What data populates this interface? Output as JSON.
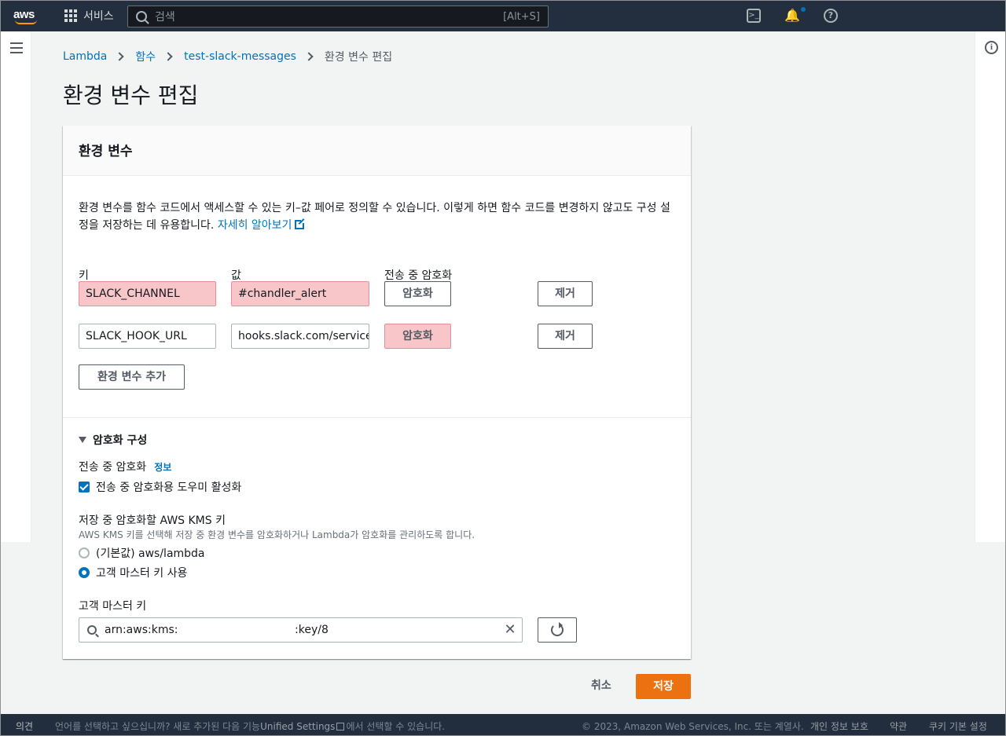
{
  "topnav": {
    "logo": "aws",
    "services_label": "서비스",
    "search_placeholder": "검색",
    "search_shortcut": "[Alt+S]",
    "cloudshell_icon": ">_",
    "bell_icon": "🔔",
    "help_icon": "?"
  },
  "breadcrumb": {
    "items": [
      "Lambda",
      "함수",
      "test-slack-messages"
    ],
    "current": "환경 변수 편집"
  },
  "page_title": "환경 변수 편집",
  "panel": {
    "header": "환경 변수",
    "description": "환경 변수를 함수 코드에서 액세스할 수 있는 키–값 페어로 정의할 수 있습니다. 이렇게 하면 함수 코드를 변경하지 않고도 구성 설정을 저장하는 데 유용합니다.",
    "learn_more": "자세히 알아보기",
    "columns": {
      "key": "키",
      "value": "값",
      "encrypt": "전송 중 암호화"
    },
    "rows": [
      {
        "key": "SLACK_CHANNEL",
        "value": "#chandler_alert",
        "encrypt_label": "암호화",
        "remove_label": "제거"
      },
      {
        "key": "SLACK_HOOK_URL",
        "value": "hooks.slack.com/services",
        "encrypt_label": "암호화",
        "remove_label": "제거"
      }
    ],
    "add_label": "환경 변수 추가"
  },
  "encryption": {
    "section_label": "암호화 구성",
    "transit_label": "전송 중 암호화",
    "info_label": "정보",
    "helper_checkbox_label": "전송 중 암호화용 도우미 활성화",
    "helper_checked": true,
    "kms_label": "저장 중 암호화할 AWS KMS 키",
    "kms_description": "AWS KMS 키를 선택해 저장 중 환경 변수를 암호화하거나 Lambda가 암호화를 관리하도록 합니다.",
    "options": [
      {
        "label": "(기본값) aws/lambda",
        "selected": false
      },
      {
        "label": "고객 마스터 키 사용",
        "selected": true
      }
    ],
    "cmk_label": "고객 마스터 키",
    "cmk_value_prefix": "arn:aws:kms:",
    "cmk_value_suffix": ":key/8"
  },
  "actions": {
    "cancel": "취소",
    "save": "저장"
  },
  "footer": {
    "feedback": "의견",
    "language_notice_a": "언어를 선택하고 싶으십니까? 새로 추가된 다음 기능",
    "unified_settings": "Unified Settings",
    "language_notice_b": "에서 선택할 수 있습니다.",
    "copyright": "© 2023, Amazon Web Services, Inc. 또는 계열사.",
    "privacy": "개인 정보 보호",
    "terms": "약관",
    "cookie": "쿠키 기본 설정"
  },
  "colors": {
    "accent": "#0073bb",
    "primary_button": "#ec7211",
    "error_fill": "#f8c6c8",
    "nav_bg": "#232f3e"
  }
}
